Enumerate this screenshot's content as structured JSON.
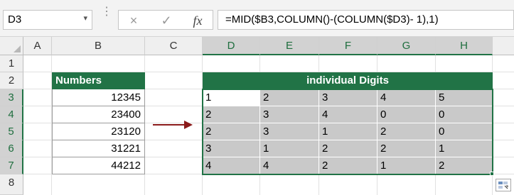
{
  "name_box": "D3",
  "formula": "=MID($B3,COLUMN()-(COLUMN($D3)- 1),1)",
  "icons": {
    "cancel": "×",
    "enter": "✓",
    "fx": "fx",
    "dropdown": "▾"
  },
  "columns": [
    "A",
    "B",
    "C",
    "D",
    "E",
    "F",
    "G",
    "H"
  ],
  "rows": [
    "1",
    "2",
    "3",
    "4",
    "5",
    "6",
    "7",
    "8"
  ],
  "numbers": {
    "header": "Numbers",
    "values": [
      "12345",
      "23400",
      "23120",
      "31221",
      "44212"
    ]
  },
  "digits": {
    "header": "individual Digits",
    "rows": [
      [
        "1",
        "2",
        "3",
        "4",
        "5"
      ],
      [
        "2",
        "3",
        "4",
        "0",
        "0"
      ],
      [
        "2",
        "3",
        "1",
        "2",
        "0"
      ],
      [
        "3",
        "1",
        "2",
        "2",
        "1"
      ],
      [
        "4",
        "4",
        "2",
        "1",
        "2"
      ]
    ]
  },
  "colors": {
    "accent": "#217346",
    "arrow": "#8b1a1a",
    "selection_fill": "#c9c9c9"
  }
}
